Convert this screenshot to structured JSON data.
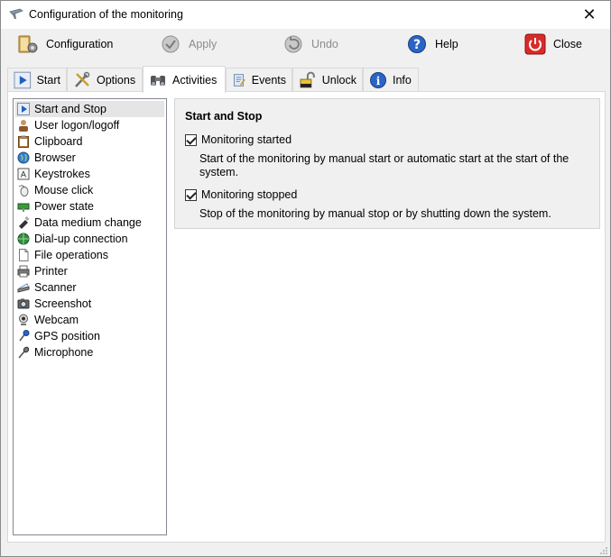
{
  "window": {
    "title": "Configuration of the monitoring",
    "close_glyph": "✕"
  },
  "toolbar": {
    "configuration": "Configuration",
    "apply": "Apply",
    "undo": "Undo",
    "help": "Help",
    "close": "Close"
  },
  "tabs": [
    {
      "label": "Start",
      "icon": "play-icon"
    },
    {
      "label": "Options",
      "icon": "tools-icon"
    },
    {
      "label": "Activities",
      "icon": "binoculars-icon",
      "active": true
    },
    {
      "label": "Events",
      "icon": "events-icon"
    },
    {
      "label": "Unlock",
      "icon": "unlock-icon"
    },
    {
      "label": "Info",
      "icon": "info-icon"
    }
  ],
  "activities": [
    {
      "label": "Start and Stop",
      "selected": true
    },
    {
      "label": "User logon/logoff"
    },
    {
      "label": "Clipboard"
    },
    {
      "label": "Browser"
    },
    {
      "label": "Keystrokes"
    },
    {
      "label": "Mouse click"
    },
    {
      "label": "Power state"
    },
    {
      "label": "Data medium change"
    },
    {
      "label": "Dial-up connection"
    },
    {
      "label": "File operations"
    },
    {
      "label": "Printer"
    },
    {
      "label": "Scanner"
    },
    {
      "label": "Screenshot"
    },
    {
      "label": "Webcam"
    },
    {
      "label": "GPS position"
    },
    {
      "label": "Microphone"
    }
  ],
  "details": {
    "title": "Start and Stop",
    "started_label": "Monitoring started",
    "started_checked": true,
    "started_desc_1": "Start of the monitoring by manual start or automatic start at the start of the",
    "started_desc_2": "system.",
    "stopped_label": "Monitoring stopped",
    "stopped_checked": true,
    "stopped_desc": "Stop of the monitoring by manual stop or by shutting down the system."
  }
}
